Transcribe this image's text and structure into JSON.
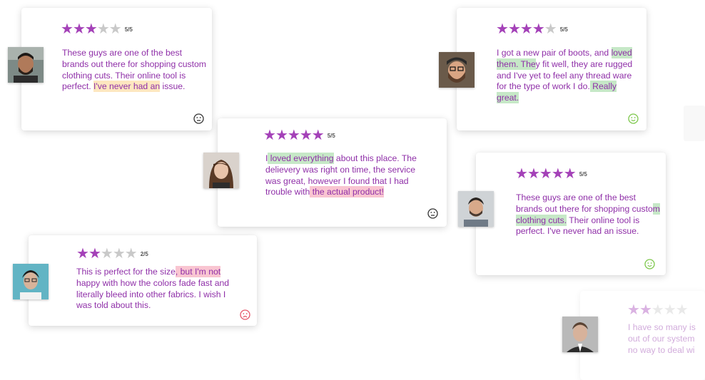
{
  "colors": {
    "star_on": "#a441b8",
    "star_off": "#c9c9c9",
    "text": "#8f2fa8",
    "highlight_yellow": "#fde7c0",
    "highlight_green": "#c6e8c7",
    "highlight_pink": "#f9c5d1",
    "neutral_emoji": "#333333",
    "happy_emoji": "#7cc74a",
    "sad_emoji": "#e5556a"
  },
  "reviews": [
    {
      "rating": 3,
      "score_label": "5/5",
      "sentiment": "neutral-face-icon",
      "parts": [
        {
          "t": "These guys are one of the best brands out there for shopping custom clothing cuts.  Their online tool is perfect. "
        },
        {
          "t": " I've never had an",
          "hl": "yellow"
        },
        {
          "t": " issue."
        }
      ]
    },
    {
      "rating": 5,
      "score_label": "5/5",
      "sentiment": "neutral-face-icon",
      "parts": [
        {
          "t": "I"
        },
        {
          "t": " loved everything",
          "hl": "green"
        },
        {
          "t": " about this place.  The delievery was right on time, the service was great, however I found that I had trouble with"
        },
        {
          "t": " the actual product!",
          "hl": "pink"
        }
      ]
    },
    {
      "rating": 2,
      "score_label": "2/5",
      "sentiment": "sad-face-icon",
      "parts": [
        {
          "t": "This is perfect for the size"
        },
        {
          "t": ", but I'm not",
          "hl": "pink"
        },
        {
          "t": " happy with how the colors fade fast and literally bleed into other fabrics. I wish I was told about this."
        }
      ]
    },
    {
      "rating": 4,
      "score_label": "5/5",
      "sentiment": "happy-face-icon",
      "parts": [
        {
          "t": "I got a new pair of boots, and "
        },
        {
          "t": "loved them. The",
          "hl": "green"
        },
        {
          "t": "y fit well, they are rugged and I've yet to feel any thread ware for the type of work I do."
        },
        {
          "t": "  Really great.",
          "hl": "green"
        }
      ]
    },
    {
      "rating": 5,
      "score_label": "5/5",
      "sentiment": "happy-face-icon",
      "parts": [
        {
          "t": "These guys are one of the best brands out there for shopping custo"
        },
        {
          "t": "m clothing cuts.",
          "hl": "green"
        },
        {
          "t": " Their online tool is perfect.  I've never had an issue."
        }
      ]
    },
    {
      "rating": 2,
      "score_label": "",
      "sentiment": "",
      "parts": [
        {
          "t": "I have so many is out of our system no way to deal wi"
        }
      ]
    }
  ]
}
